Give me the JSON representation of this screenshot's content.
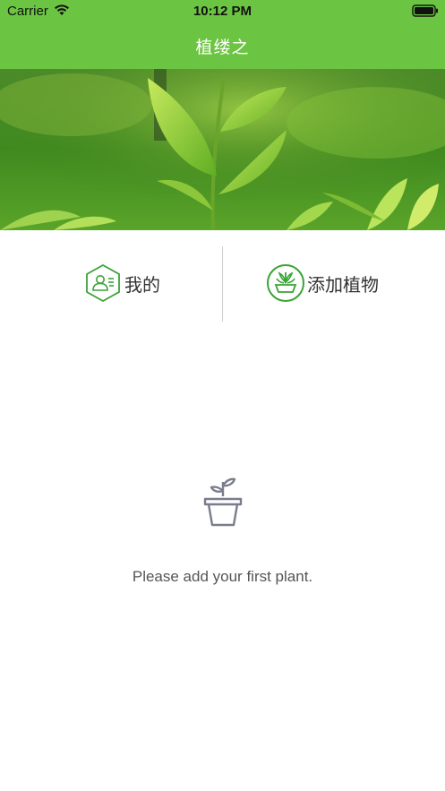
{
  "status_bar": {
    "carrier": "Carrier",
    "time": "10:12 PM"
  },
  "nav": {
    "title": "植缕之"
  },
  "actions": {
    "mine_label": "我的",
    "add_plant_label": "添加植物"
  },
  "empty_state": {
    "message": "Please add your first plant.",
    "icon": "plant-pot-icon"
  },
  "colors": {
    "brand_green": "#6cc542",
    "icon_green": "#3aa335",
    "icon_gray": "#7a7d8c"
  }
}
